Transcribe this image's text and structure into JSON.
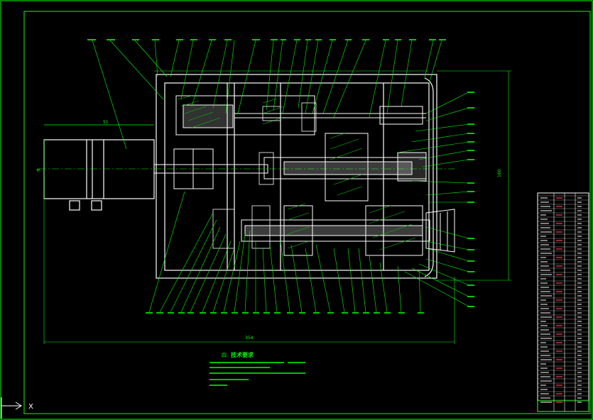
{
  "colors": {
    "background": "#000000",
    "frame": "#00ff00",
    "outline": "#ffffff",
    "leader": "#00ff00",
    "hatch": "#00cc00",
    "label": "#00ff00",
    "section_fill": "#c8c8c8"
  },
  "icons": {
    "ucs_icon": "ucs-axis-icon"
  },
  "ucs": {
    "axis_x": "X"
  },
  "drawing": {
    "tech_title": "技术要求",
    "tech_number": "四",
    "dim_center": "Φ",
    "dim_bottom": "354",
    "dim_side": "160",
    "dim_top": "51"
  }
}
